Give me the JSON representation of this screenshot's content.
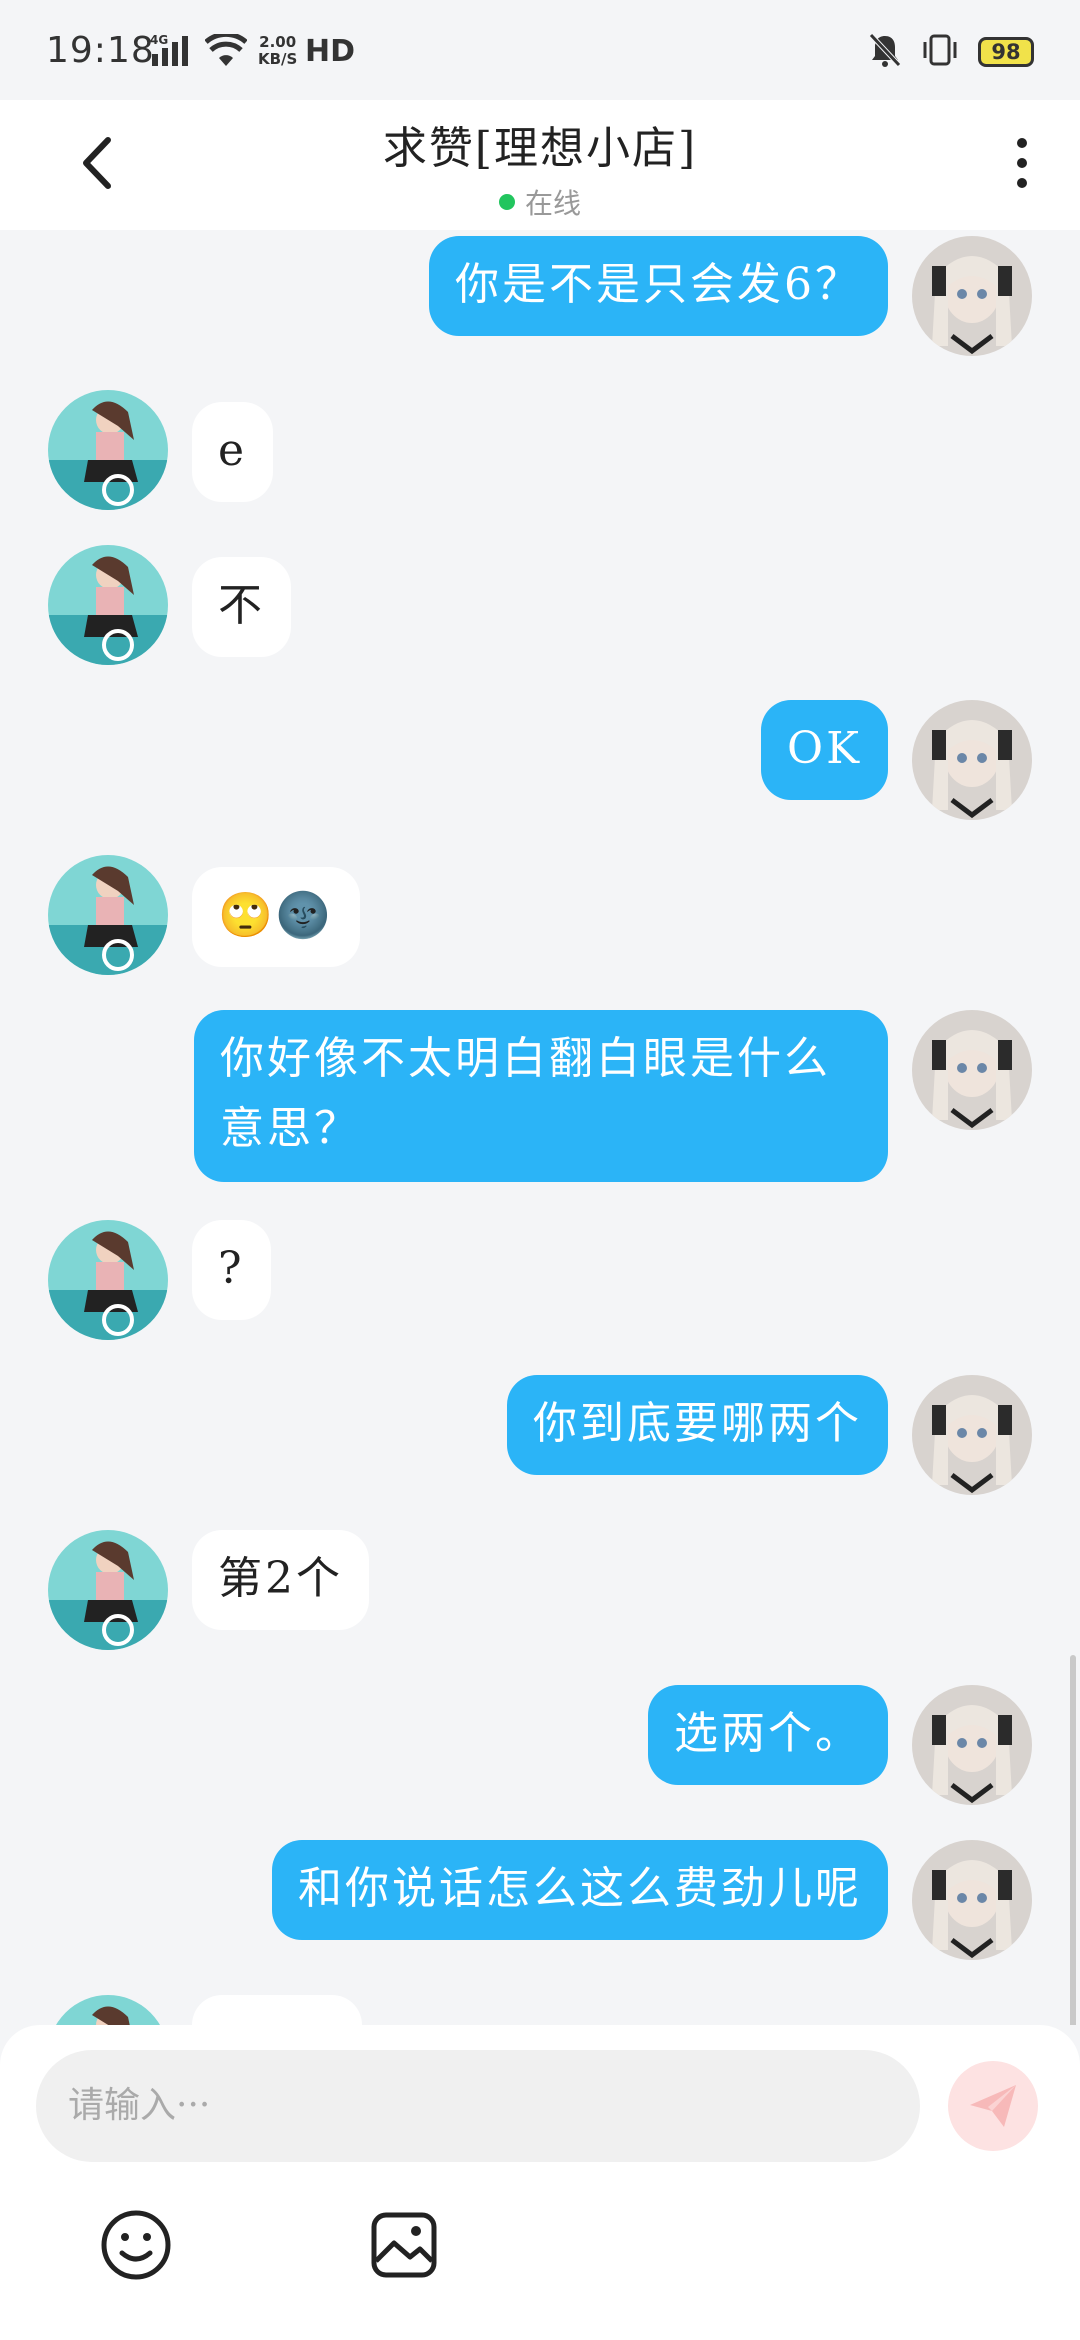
{
  "status_bar": {
    "time": "19:18",
    "network": "4G",
    "speed_top": "2.00",
    "speed_bottom": "KB/S",
    "hd": "HD",
    "battery": "98"
  },
  "header": {
    "title": "求赞[理想小店]",
    "status": "在线",
    "status_color": "#22c55e"
  },
  "messages": [
    {
      "from": "me",
      "text": "你是不是只会发6？"
    },
    {
      "from": "other",
      "text": "e"
    },
    {
      "from": "other",
      "text": "不"
    },
    {
      "from": "me",
      "text": "OK"
    },
    {
      "from": "other",
      "text": "🙄🌚"
    },
    {
      "from": "me",
      "text": "你好像不太明白翻白眼是什么意思？"
    },
    {
      "from": "other",
      "text": "?"
    },
    {
      "from": "me",
      "text": "你到底要哪两个"
    },
    {
      "from": "other",
      "text": "第2个"
    },
    {
      "from": "me",
      "text": "选两个。"
    },
    {
      "from": "me",
      "text": "和你说话怎么这么费劲儿呢"
    }
  ],
  "input": {
    "placeholder": "请输入···"
  },
  "colors": {
    "my_bubble": "#2bb4f7",
    "other_bubble": "#ffffff",
    "background": "#f4f5f7"
  },
  "icons": [
    "back-arrow-icon",
    "more-icon",
    "send-icon",
    "emoji-icon",
    "image-icon"
  ]
}
